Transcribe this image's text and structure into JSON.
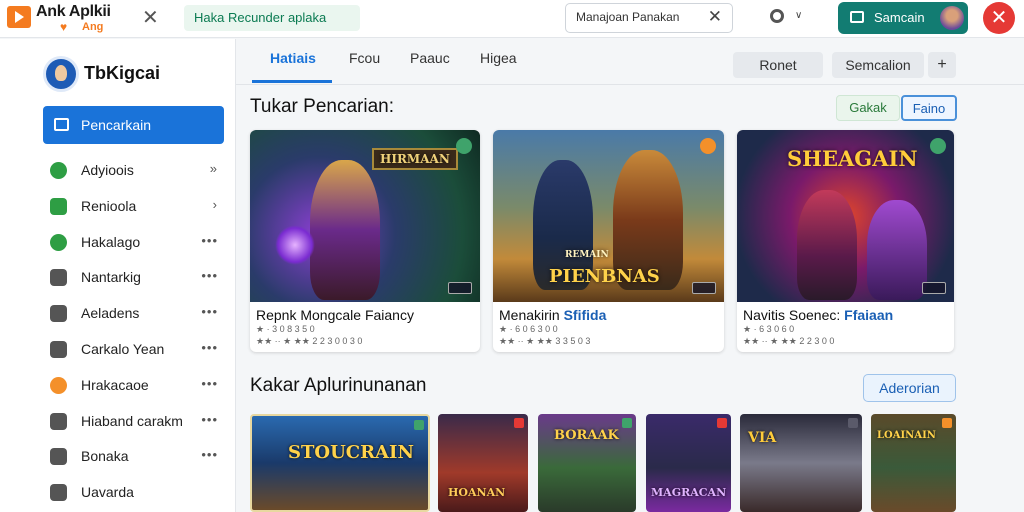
{
  "app": {
    "title": "Ank Aplkii",
    "subtitle": "Ang",
    "tab_label": "Haka Recunder aplaka"
  },
  "search": {
    "value": "Manajoan Panakan",
    "placeholder": ""
  },
  "header": {
    "primary_button_label": "Samcain"
  },
  "sidebar": {
    "brand": "TbKigcai",
    "active_item": "Pencarkain",
    "items": [
      {
        "label": "Adyioois",
        "trail": "»",
        "icon": "check-circle-icon",
        "color": "#2e9e44"
      },
      {
        "label": "Renioola",
        "trail": "›",
        "icon": "check-square-icon",
        "color": "#2e9e44"
      },
      {
        "label": "Hakalago",
        "trail": "•••",
        "icon": "shield-icon",
        "color": "#2e9e44"
      },
      {
        "label": "Nantarkig",
        "trail": "•••",
        "icon": "bookmark-icon",
        "color": "#555555"
      },
      {
        "label": "Aeladens",
        "trail": "•••",
        "icon": "mail-icon",
        "color": "#555555"
      },
      {
        "label": "Carkalo Yean",
        "trail": "•••",
        "icon": "heart-shield-icon",
        "color": "#555555"
      },
      {
        "label": "Hrakacaoe",
        "trail": "•••",
        "icon": "orange-circle-icon",
        "color": "#f4902a"
      },
      {
        "label": "Hiaband carakm",
        "trail": "•••",
        "icon": "document-icon",
        "color": "#555555"
      },
      {
        "label": "Bonaka",
        "trail": "•••",
        "icon": "paw-icon",
        "color": "#555555"
      },
      {
        "label": "Uavarda",
        "trail": "",
        "icon": "card-icon",
        "color": "#555555"
      }
    ]
  },
  "main": {
    "tabs": [
      {
        "label": "Hatiais",
        "active": true
      },
      {
        "label": "Fcou",
        "active": false
      },
      {
        "label": "Paauc",
        "active": false
      },
      {
        "label": "Higea",
        "active": false
      }
    ],
    "right_buttons": [
      "Ronet",
      "Semcalion"
    ],
    "plus_label": "+",
    "section1": {
      "title": "Tukar Pencarian:",
      "segments": [
        "Gakak",
        "Faino"
      ],
      "cards": [
        {
          "title": "Repnk Mongcale Faiancy",
          "title_hl": "",
          "meta1": "★ · 3 0 8 3 5 0",
          "meta2": "★★ ·· ★ ★★ 2 2 3 0 0 3 0",
          "art_text": "HIRMAAN"
        },
        {
          "title": "Menakirin ",
          "title_hl": "Sfifida",
          "meta1": "★ · 6 0 6 3 0 0",
          "meta2": "★★ ·· ★ ★★ 3 3 5 0 3",
          "art_text": "PIENBNAS",
          "art_small": "REMAIN"
        },
        {
          "title": "Navitis Soenec: ",
          "title_hl": "Ffaiaan",
          "meta1": "★ · 6 3 0 6 0",
          "meta2": "★★ ·· ★ ★★ 2 2 3 0 0",
          "art_text": "SHEAGAIN"
        }
      ]
    },
    "section2": {
      "title": "Kakar Aplurinunanan",
      "more_label": "Aderorian",
      "thumbs": [
        {
          "text": "STOUCRAIN"
        },
        {
          "text": "HOANAN"
        },
        {
          "text": "BORAAK"
        },
        {
          "text": "MAGRACAN"
        },
        {
          "text": "VIA"
        },
        {
          "text": "LOAINAIN"
        }
      ]
    }
  }
}
